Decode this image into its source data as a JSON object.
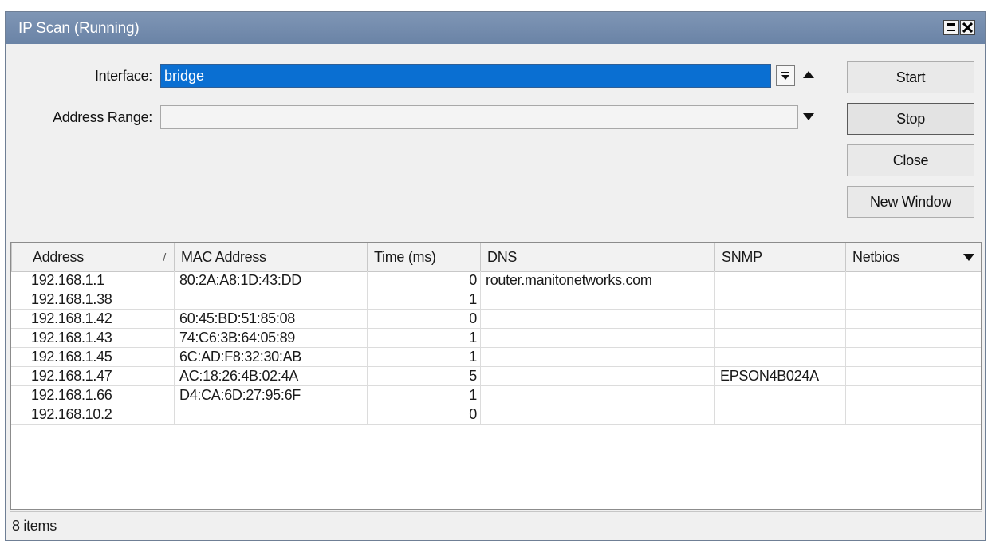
{
  "window": {
    "title": "IP Scan (Running)"
  },
  "form": {
    "interface_label": "Interface:",
    "interface_value": "bridge",
    "address_range_label": "Address Range:",
    "address_range_value": ""
  },
  "buttons": {
    "start": "Start",
    "stop": "Stop",
    "close": "Close",
    "new_window": "New Window"
  },
  "table": {
    "columns": [
      "Address",
      "MAC Address",
      "Time (ms)",
      "DNS",
      "SNMP",
      "Netbios"
    ],
    "sorted_column": "Address",
    "rows": [
      [
        "192.168.1.1",
        "80:2A:A8:1D:43:DD",
        "0",
        "router.manitonetworks.com",
        "",
        ""
      ],
      [
        "192.168.1.38",
        "",
        "1",
        "",
        "",
        ""
      ],
      [
        "192.168.1.42",
        "60:45:BD:51:85:08",
        "0",
        "",
        "",
        ""
      ],
      [
        "192.168.1.43",
        "74:C6:3B:64:05:89",
        "1",
        "",
        "",
        ""
      ],
      [
        "192.168.1.45",
        "6C:AD:F8:32:30:AB",
        "1",
        "",
        "",
        ""
      ],
      [
        "192.168.1.47",
        "AC:18:26:4B:02:4A",
        "5",
        "",
        "EPSON4B024A",
        ""
      ],
      [
        "192.168.1.66",
        "D4:CA:6D:27:95:6F",
        "1",
        "",
        "",
        ""
      ],
      [
        "192.168.10.2",
        "",
        "0",
        "",
        "",
        ""
      ]
    ]
  },
  "status": {
    "count_text": "8 items"
  }
}
